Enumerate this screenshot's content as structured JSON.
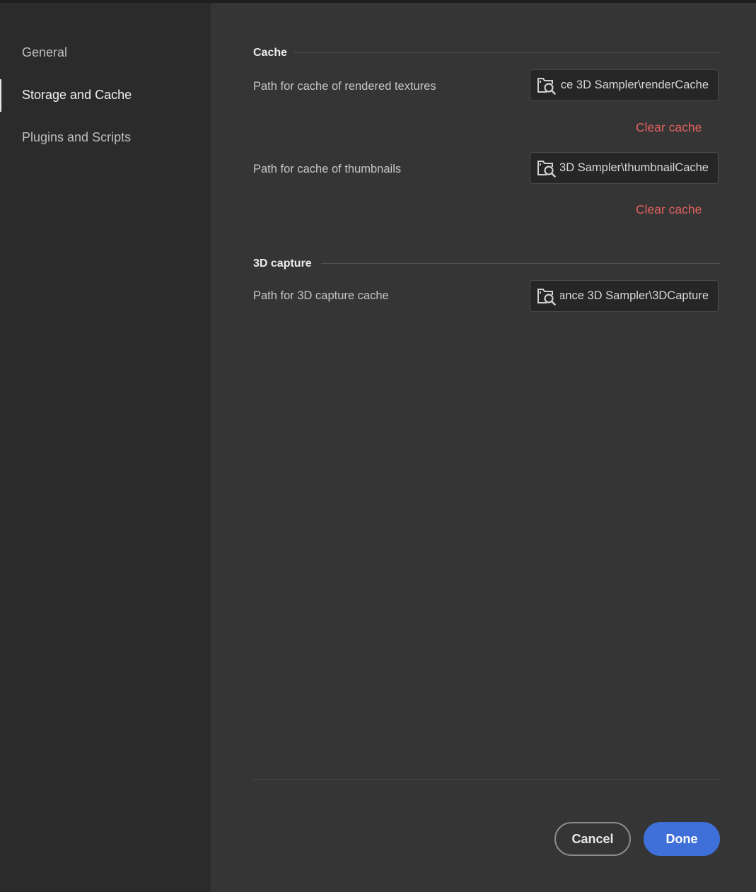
{
  "sidebar": {
    "items": [
      {
        "label": "General",
        "active": false
      },
      {
        "label": "Storage and Cache",
        "active": true
      },
      {
        "label": "Plugins and Scripts",
        "active": false
      }
    ]
  },
  "cache_section": {
    "title": "Cache",
    "rendered_textures": {
      "label": "Path for cache of rendered textures",
      "path_visible": "ıce 3D Sampler\\renderCache",
      "clear_label": "Clear cache"
    },
    "thumbnails": {
      "label": "Path for cache of thumbnails",
      "path_visible": "3D Sampler\\thumbnailCache",
      "clear_label": "Clear cache"
    }
  },
  "capture_section": {
    "title": "3D capture",
    "capture_cache": {
      "label": "Path for 3D capture cache",
      "path_visible": "ance 3D Sampler\\3DCapture"
    }
  },
  "footer": {
    "cancel_label": "Cancel",
    "done_label": "Done"
  },
  "colors": {
    "accent": "#3f6fd8",
    "clear_link": "#e0625f",
    "sidebar_bg": "#2c2b2b",
    "main_bg": "#353535"
  },
  "icons": {
    "folder_search": "folder-search-icon"
  }
}
